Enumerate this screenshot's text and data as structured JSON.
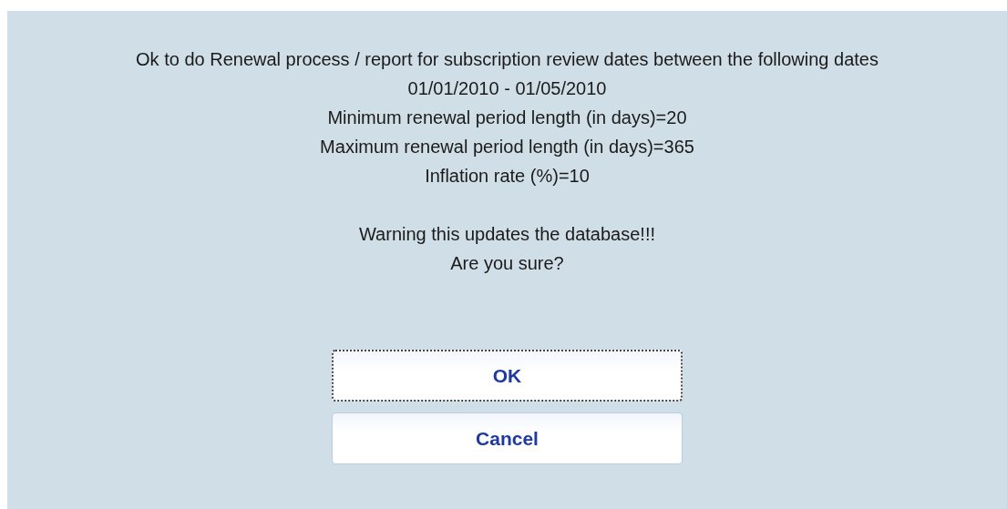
{
  "message_lines": [
    "Ok to do Renewal process / report for subscription review dates between the following dates",
    "01/01/2010 - 01/05/2010",
    "Minimum renewal period length (in days)=20",
    "Maximum renewal period length (in days)=365",
    "Inflation rate (%)=10"
  ],
  "warning_lines": [
    "Warning this updates the database!!!",
    "Are you sure?"
  ],
  "buttons": [
    {
      "label": "OK",
      "focused": true
    },
    {
      "label": "Cancel",
      "focused": false
    }
  ]
}
